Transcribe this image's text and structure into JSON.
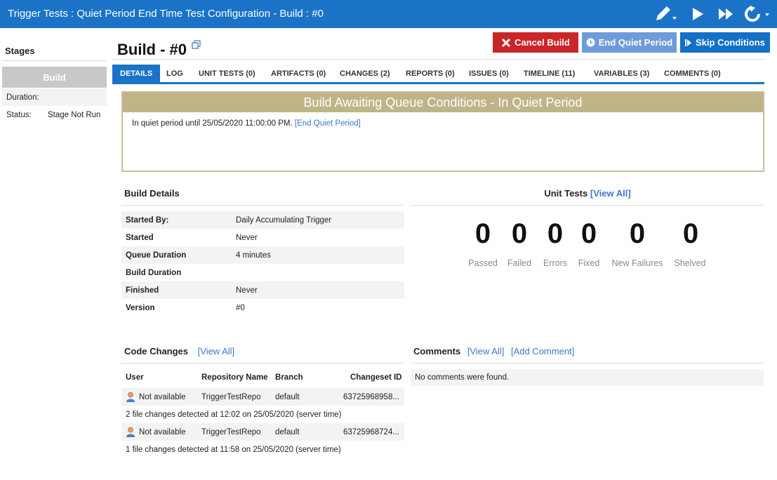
{
  "window": {
    "title": "Trigger Tests : Quiet Period End Time Test Configuration - Build : #0",
    "toolbar_icons": [
      "edit-icon",
      "play-icon",
      "fast-forward-icon",
      "refresh-icon"
    ],
    "colors": {
      "titlebar": "#1a73c7",
      "accent": "#1a73c7",
      "danger": "#c9262a"
    }
  },
  "sidebar": {
    "title": "Stages",
    "stage_label": "Build",
    "duration_label": "Duration:",
    "duration_value": "",
    "status_label": "Status:",
    "status_value": "Stage Not Run"
  },
  "header": {
    "title": "Build - #0",
    "buttons": {
      "cancel": "Cancel Build",
      "end_quiet": "End Quiet Period",
      "skip": "Skip Conditions"
    }
  },
  "tabs": [
    {
      "label": "DETAILS",
      "active": true
    },
    {
      "label": "LOG"
    },
    {
      "label": "UNIT TESTS (0)"
    },
    {
      "label": "ARTIFACTS (0)"
    },
    {
      "label": "CHANGES (2)"
    },
    {
      "label": "REPORTS (0)"
    },
    {
      "label": "ISSUES (0)"
    },
    {
      "label": "TIMELINE (11)"
    },
    {
      "label": "VARIABLES (3)"
    },
    {
      "label": "COMMENTS (0)"
    }
  ],
  "alert": {
    "title": "Build Awaiting Queue Conditions - In Quiet Period",
    "message": "In quiet period until 25/05/2020 11:00:00 PM.",
    "link": "[End Quiet Period]"
  },
  "build_details": {
    "title": "Build Details",
    "rows": [
      {
        "key": "Started By:",
        "value": "Daily Accumulating Trigger"
      },
      {
        "key": "Started",
        "value": "Never"
      },
      {
        "key": "Queue Duration",
        "value": "4 minutes"
      },
      {
        "key": "Build Duration",
        "value": ""
      },
      {
        "key": "Finished",
        "value": "Never"
      },
      {
        "key": "Version",
        "value": "#0"
      }
    ]
  },
  "unit_tests": {
    "title": "Unit Tests",
    "link": "[View All]",
    "stats": [
      {
        "label": "Passed",
        "value": "0"
      },
      {
        "label": "Failed",
        "value": "0"
      },
      {
        "label": "Errors",
        "value": "0"
      },
      {
        "label": "Fixed",
        "value": "0"
      },
      {
        "label": "New Failures",
        "value": "0"
      },
      {
        "label": "Shelved",
        "value": "0"
      }
    ]
  },
  "code_changes": {
    "title": "Code Changes",
    "link": "[View All]",
    "headers": {
      "user": "User",
      "repo": "Repository Name",
      "branch": "Branch",
      "changeset": "Changeset ID"
    },
    "rows": [
      {
        "user": "Not available",
        "repo": "TriggerTestRepo",
        "branch": "default",
        "changeset": "63725968958...",
        "summary": "2 file changes detected at 12:02 on 25/05/2020 (server time)"
      },
      {
        "user": "Not available",
        "repo": "TriggerTestRepo",
        "branch": "default",
        "changeset": "63725968724...",
        "summary": "1 file changes detected at 11:58 on 25/05/2020 (server time)"
      }
    ]
  },
  "comments": {
    "title": "Comments",
    "view_all": "[View All]",
    "add": "[Add Comment]",
    "empty": "No comments were found."
  }
}
